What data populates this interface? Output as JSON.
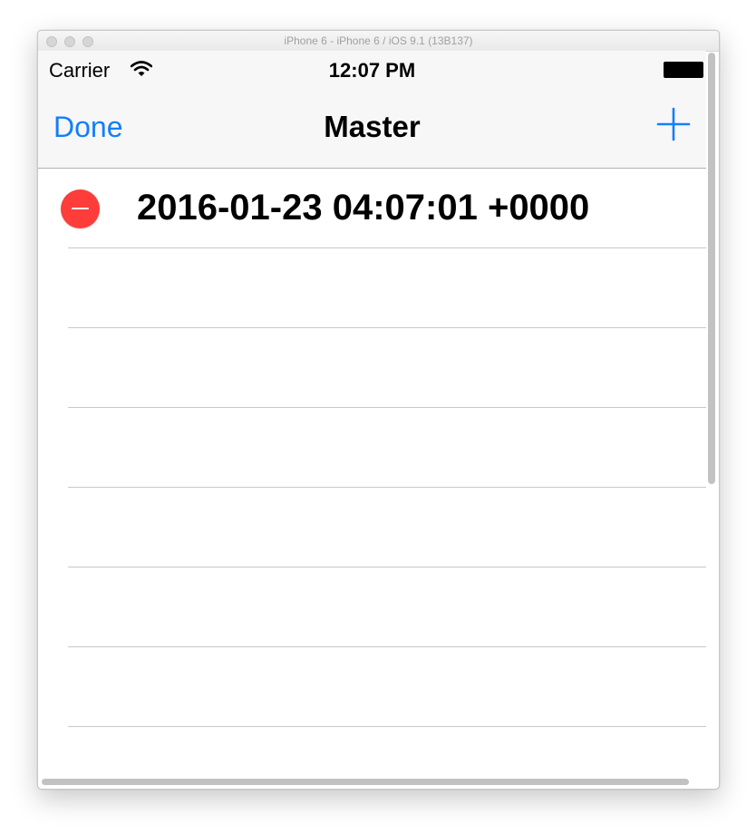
{
  "window": {
    "title": "iPhone 6 - iPhone 6 / iOS 9.1 (13B137)"
  },
  "status_bar": {
    "carrier": "Carrier",
    "time": "12:07 PM",
    "icons": [
      "wifi-icon",
      "battery-icon"
    ]
  },
  "navigation": {
    "left_button": "Done",
    "title": "Master",
    "right_button_icon": "plus-icon"
  },
  "table": {
    "rows": [
      {
        "label": "2016-01-23 04:07:01 +0000",
        "editing_icon": "delete-minus-icon"
      },
      {
        "label": ""
      },
      {
        "label": ""
      },
      {
        "label": ""
      },
      {
        "label": ""
      },
      {
        "label": ""
      },
      {
        "label": ""
      }
    ]
  },
  "colors": {
    "tint": "#147efb",
    "delete": "#fc3d39",
    "separator": "#c8c7cc",
    "navbar_bg": "#f7f7f7"
  }
}
